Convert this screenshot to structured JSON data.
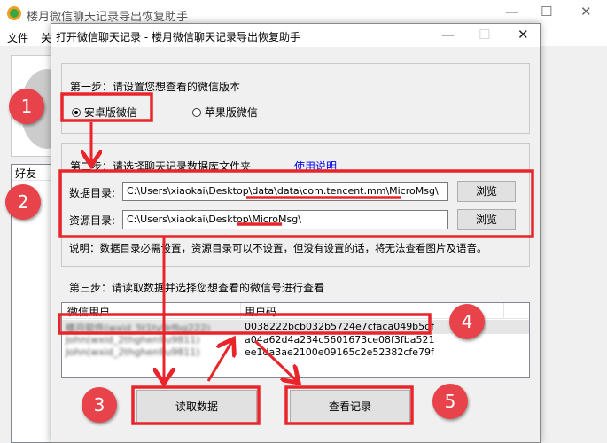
{
  "main_window": {
    "title": "楼月微信聊天记录导出恢复助手",
    "menu": [
      "文件",
      "关"
    ],
    "friends_header": "好友"
  },
  "dialog": {
    "title": "打开微信聊天记录 - 楼月微信聊天记录导出恢复助手",
    "step1": {
      "label": "第一步：请设置您想查看的微信版本",
      "android": "安卓版微信",
      "ios": "苹果版微信",
      "selected": "android"
    },
    "step2": {
      "label": "第二步：请选择聊天记录数据库文件夹",
      "help_link": "使用说明",
      "data_dir_label": "数据目录:",
      "data_dir_value": "C:\\Users\\xiaokai\\Desktop\\data\\data\\com.tencent.mm\\MicroMsg\\",
      "res_dir_label": "资源目录:",
      "res_dir_value": "C:\\Users\\xiaokai\\Desktop\\MicroMsg\\",
      "browse": "浏览",
      "note": "说明：数据目录必需设置，资源目录可以不设置，但没有设置的话，将无法查看图片及语音。"
    },
    "step3": {
      "label": "第三步：请读取数据并选择您想查看的微信号进行查看",
      "columns": [
        "微信用户",
        "用户码"
      ],
      "rows": [
        {
          "user": "楼月软件(wxid_5t1ty9rfbg222)",
          "code": "0038222bcb032b5724e7cfaca049b5df"
        },
        {
          "user": "John(wxid_2thghen9u9811)",
          "code": "a04a62d4a234c5601673ce08f3fba521"
        },
        {
          "user": "John(wxid_2thghen9u9811)",
          "code": "ee1da3ae2100e09165c2e52382cfe79f"
        }
      ]
    },
    "read_button": "读取数据",
    "view_button": "查看记录"
  },
  "annotations": {
    "steps": [
      "1",
      "2",
      "3",
      "4",
      "5"
    ],
    "color": "#e8252b"
  }
}
